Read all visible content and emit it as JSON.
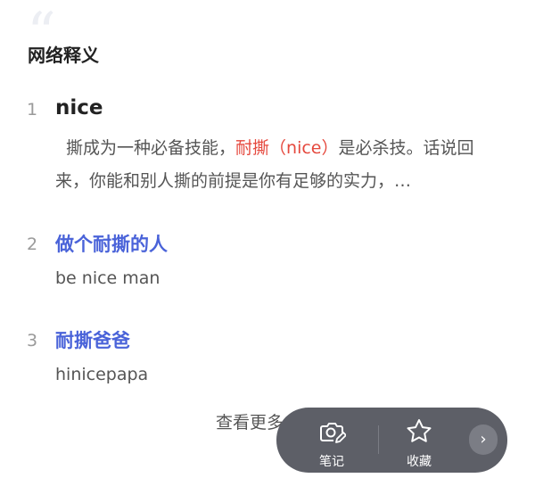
{
  "section": {
    "title": "网络释义"
  },
  "entries": [
    {
      "num": "1",
      "head": "nice",
      "text_before": "撕成为一种必备技能，",
      "highlight": "耐撕",
      "text_mid": "（nice）",
      "text_after": "是必杀技。话说回来，你能和别人撕的前提是你有足够的实力，…"
    },
    {
      "num": "2",
      "head": "做个耐撕的人",
      "translation": "be nice man"
    },
    {
      "num": "3",
      "head": "耐撕爸爸",
      "translation": "hinicepapa"
    }
  ],
  "more": {
    "label": "查看更多"
  },
  "toolbar": {
    "note_label": "笔记",
    "fav_label": "收藏",
    "next_icon": "chevron-right-icon",
    "next_glyph": "›"
  }
}
